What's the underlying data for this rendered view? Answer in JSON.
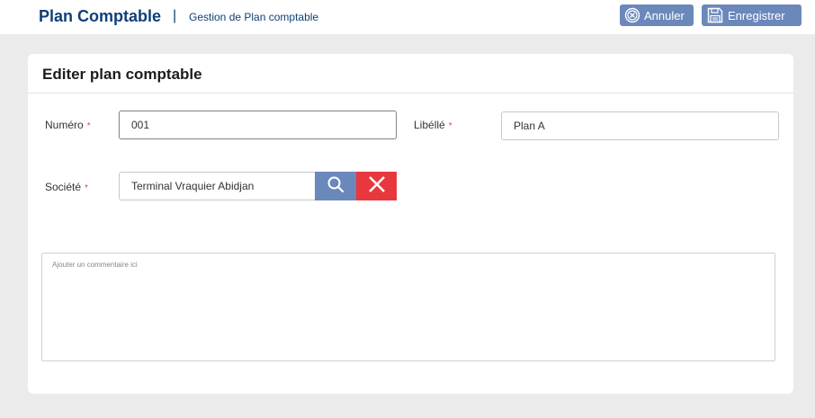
{
  "header": {
    "app_title": "Plan Comptable",
    "separator": "|",
    "subtitle": "Gestion de Plan comptable",
    "cancel_label": "Annuler",
    "save_label": "Enregistrer",
    "cancel_icon": "cancel-circle-icon",
    "save_icon": "floppy-disk-icon"
  },
  "form": {
    "title": "Editer plan comptable",
    "required_marker": "*",
    "numero": {
      "label": "Numéro",
      "value": "001"
    },
    "libelle": {
      "label": "Libéllé",
      "value": "Plan A"
    },
    "societe": {
      "label": "Société",
      "value": "Terminal Vraquier Abidjan"
    },
    "comment": {
      "placeholder": "Ajouter un commentaire ici"
    }
  },
  "colors": {
    "brand": "#0f3f77",
    "button": "#6b88bb",
    "danger": "#e8383d",
    "required": "#e04848"
  }
}
